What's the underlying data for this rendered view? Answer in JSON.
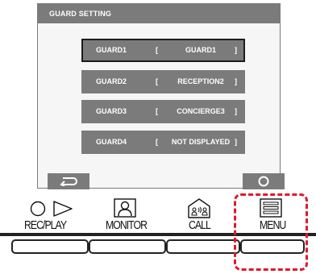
{
  "screen": {
    "title": "GUARD SETTING",
    "guards": [
      {
        "name": "GUARD1",
        "bracket_open": "[",
        "value": "GUARD1",
        "bracket_close": "]",
        "selected": true
      },
      {
        "name": "GUARD2",
        "bracket_open": "[",
        "value": "RECEPTION2",
        "bracket_close": "]",
        "selected": false
      },
      {
        "name": "GUARD3",
        "bracket_open": "[",
        "value": "CONCIERGE3",
        "bracket_close": "]",
        "selected": false
      },
      {
        "name": "GUARD4",
        "bracket_open": "[",
        "value": "NOT DISPLAYED",
        "bracket_close": "]",
        "selected": false
      }
    ],
    "back_button_icon": "return-arrow-icon",
    "ok_button_icon": "circle-icon"
  },
  "panel": {
    "buttons": [
      {
        "label": "REC/PLAY",
        "icon": "circle-triangle-icon"
      },
      {
        "label": "MONITOR",
        "icon": "person-frame-icon"
      },
      {
        "label": "CALL",
        "icon": "concierge-call-icon"
      },
      {
        "label": "MENU",
        "icon": "menu-list-icon"
      }
    ],
    "highlight_color": "#e1192b"
  }
}
